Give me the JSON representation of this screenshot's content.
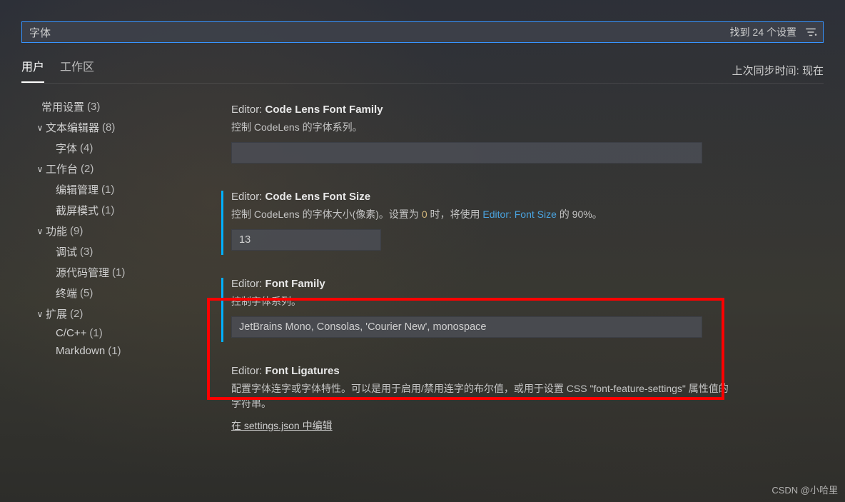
{
  "search": {
    "value": "字体",
    "result_count_label": "找到 24 个设置"
  },
  "tabs": {
    "user": "用户",
    "workspace": "工作区"
  },
  "sync_label": "上次同步时间: 现在",
  "sidebar": {
    "items": [
      {
        "label": "常用设置",
        "count": "(3)",
        "level": 0,
        "chevron": ""
      },
      {
        "label": "文本编辑器",
        "count": "(8)",
        "level": 1,
        "chevron": "∨"
      },
      {
        "label": "字体",
        "count": "(4)",
        "level": 2,
        "chevron": ""
      },
      {
        "label": "工作台",
        "count": "(2)",
        "level": 1,
        "chevron": "∨"
      },
      {
        "label": "编辑管理",
        "count": "(1)",
        "level": 2,
        "chevron": ""
      },
      {
        "label": "截屏模式",
        "count": "(1)",
        "level": 2,
        "chevron": ""
      },
      {
        "label": "功能",
        "count": "(9)",
        "level": 1,
        "chevron": "∨"
      },
      {
        "label": "调试",
        "count": "(3)",
        "level": 2,
        "chevron": ""
      },
      {
        "label": "源代码管理",
        "count": "(1)",
        "level": 2,
        "chevron": ""
      },
      {
        "label": "终端",
        "count": "(5)",
        "level": 2,
        "chevron": ""
      },
      {
        "label": "扩展",
        "count": "(2)",
        "level": 1,
        "chevron": "∨"
      },
      {
        "label": "C/C++",
        "count": "(1)",
        "level": 2,
        "chevron": ""
      },
      {
        "label": "Markdown",
        "count": "(1)",
        "level": 2,
        "chevron": ""
      }
    ]
  },
  "settings": {
    "codeLensFontFamily": {
      "prefix": "Editor:",
      "name": "Code Lens Font Family",
      "desc": "控制 CodeLens 的字体系列。",
      "value": ""
    },
    "codeLensFontSize": {
      "prefix": "Editor:",
      "name": "Code Lens Font Size",
      "desc_pre": "控制 CodeLens 的字体大小(像素)。设置为 ",
      "desc_code": "0",
      "desc_mid": " 时，将使用 ",
      "desc_link": "Editor: Font Size",
      "desc_post": " 的 90%。",
      "value": "13"
    },
    "fontFamily": {
      "prefix": "Editor:",
      "name": "Font Family",
      "desc": "控制字体系列。",
      "value": "JetBrains Mono, Consolas, 'Courier New', monospace"
    },
    "fontLigatures": {
      "prefix": "Editor:",
      "name": "Font Ligatures",
      "desc": "配置字体连字或字体特性。可以是用于启用/禁用连字的布尔值，或用于设置 CSS \"font-feature-settings\" 属性值的字符串。",
      "edit_link": "在 settings.json 中编辑"
    }
  },
  "watermark": "CSDN @小哈里"
}
